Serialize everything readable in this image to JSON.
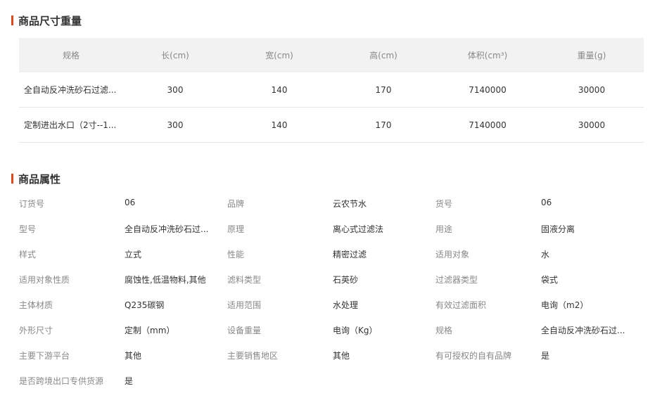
{
  "size_section": {
    "title": "商品尺寸重量",
    "headers": [
      "规格",
      "长(cm)",
      "宽(cm)",
      "高(cm)",
      "体积(cm³)",
      "重量(g)"
    ],
    "rows": [
      [
        "全自动反冲洗砂石过滤...",
        "300",
        "140",
        "170",
        "7140000",
        "30000"
      ],
      [
        "定制进出水口（2寸--1...",
        "300",
        "140",
        "170",
        "7140000",
        "30000"
      ]
    ]
  },
  "attr_section": {
    "title": "商品属性",
    "rows": [
      [
        [
          "订货号",
          "06"
        ],
        [
          "品牌",
          "云农节水"
        ],
        [
          "货号",
          "06"
        ]
      ],
      [
        [
          "型号",
          "全自动反冲洗砂石过..."
        ],
        [
          "原理",
          "离心式过滤法"
        ],
        [
          "用途",
          "固液分离"
        ]
      ],
      [
        [
          "样式",
          "立式"
        ],
        [
          "性能",
          "精密过滤"
        ],
        [
          "适用对象",
          "水"
        ]
      ],
      [
        [
          "适用对象性质",
          "腐蚀性,低温物料,其他"
        ],
        [
          "滤料类型",
          "石英砂"
        ],
        [
          "过滤器类型",
          "袋式"
        ]
      ],
      [
        [
          "主体材质",
          "Q235碳钢"
        ],
        [
          "适用范围",
          "水处理"
        ],
        [
          "有效过滤面积",
          "电询（m2）"
        ]
      ],
      [
        [
          "外形尺寸",
          "定制（mm）"
        ],
        [
          "设备重量",
          "电询（Kg）"
        ],
        [
          "规格",
          "全自动反冲洗砂石过..."
        ]
      ],
      [
        [
          "主要下游平台",
          "其他"
        ],
        [
          "主要销售地区",
          "其他"
        ],
        [
          "有可授权的自有品牌",
          "是"
        ]
      ],
      [
        [
          "是否跨境出口专供货源",
          "是"
        ]
      ]
    ]
  },
  "colors": {
    "accent": "#e4461a",
    "header_bg": "#f2f2f2",
    "label": "#888888",
    "text": "#333333"
  }
}
